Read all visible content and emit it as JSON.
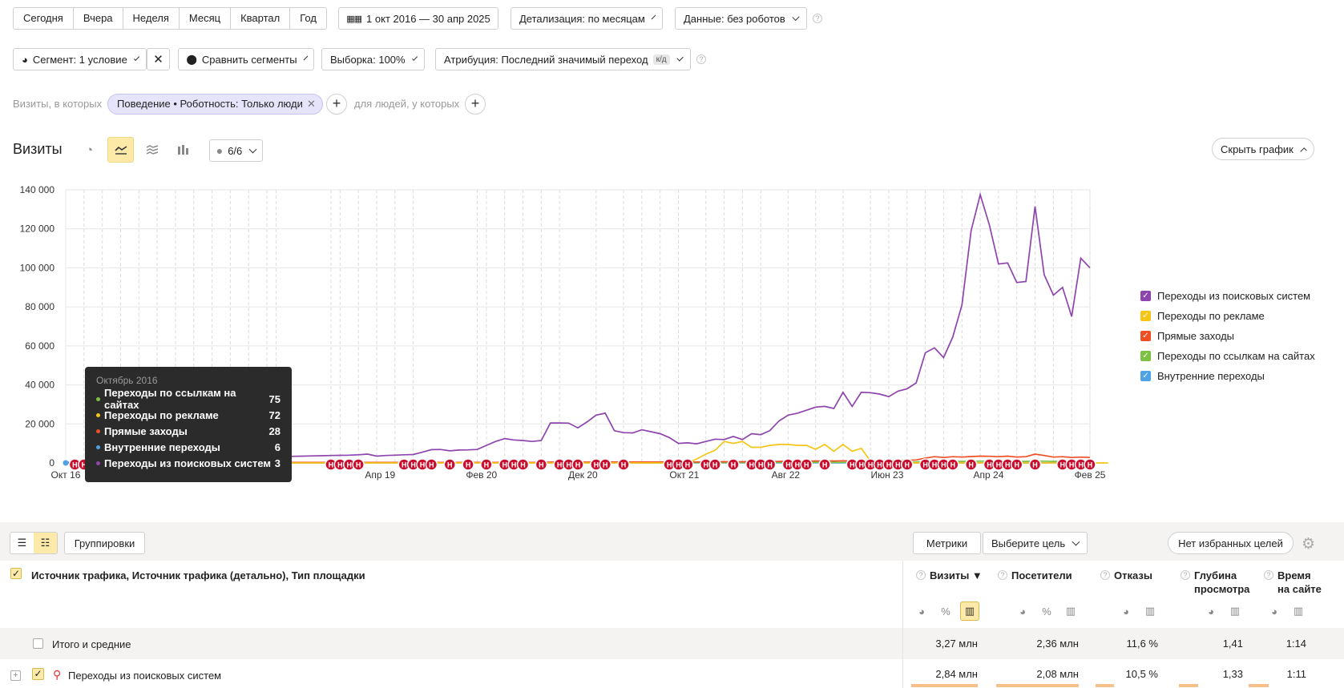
{
  "period_buttons": [
    "Сегодня",
    "Вчера",
    "Неделя",
    "Месяц",
    "Квартал",
    "Год"
  ],
  "date_range": "1 окт 2016 — 30 апр 2025",
  "detail_label": "Детализация: по месяцам",
  "data_label": "Данные: без роботов",
  "segment_label": "Сегмент: 1 условие",
  "compare_label": "Сравнить сегменты",
  "sample_label": "Выборка: 100%",
  "attribution_label": "Атрибуция: Последний значимый переход",
  "attribution_badge": "к/д",
  "visits_in_label": "Визиты, в которых",
  "filter_chip": "Поведение • Роботность: Только люди",
  "people_label": "для людей, у которых",
  "section_title": "Визиты",
  "annotations_count": "6/6",
  "hide_chart_label": "Скрыть график",
  "legend": [
    {
      "label": "Переходы из поисковых систем",
      "color": "#8e44ad"
    },
    {
      "label": "Переходы по рекламе",
      "color": "#f5c518"
    },
    {
      "label": "Прямые заходы",
      "color": "#f04e23"
    },
    {
      "label": "Переходы по ссылкам на сайтах",
      "color": "#7cc142"
    },
    {
      "label": "Внутренние переходы",
      "color": "#4da3e6"
    }
  ],
  "tooltip": {
    "title": "Октябрь 2016",
    "rows": [
      {
        "label": "Переходы по ссылкам на сайтах",
        "value": "75",
        "color": "#7cc142"
      },
      {
        "label": "Переходы по рекламе",
        "value": "72",
        "color": "#f5c518"
      },
      {
        "label": "Прямые заходы",
        "value": "28",
        "color": "#f04e23"
      },
      {
        "label": "Внутренние переходы",
        "value": "6",
        "color": "#4da3e6"
      },
      {
        "label": "Переходы из поисковых систем",
        "value": "3",
        "color": "#8e44ad"
      }
    ]
  },
  "chart_data": {
    "type": "line",
    "y_ticks": [
      "140 000",
      "120 000",
      "100 000",
      "80 000",
      "60 000",
      "40 000",
      "20 000",
      "0"
    ],
    "ylim": [
      0,
      140000
    ],
    "x_ticks": [
      "Окт 16",
      "Апр 19",
      "Фев 20",
      "Дек 20",
      "Окт 21",
      "Авг 22",
      "Июн 23",
      "Апр 24",
      "Фев 25"
    ],
    "x_months": [
      "2016-10",
      "2025-04"
    ],
    "series": [
      {
        "name": "Переходы из поисковых систем",
        "color": "#8e44ad",
        "values": [
          3,
          800,
          1100,
          1200,
          1400,
          1500,
          1600,
          1700,
          1800,
          1900,
          2000,
          2100,
          2200,
          2300,
          2400,
          2500,
          2600,
          2700,
          2800,
          2900,
          3000,
          3000,
          3100,
          3200,
          3300,
          3400,
          3500,
          3600,
          3700,
          3800,
          3900,
          4000,
          4200,
          4500,
          3500,
          3800,
          4000,
          4200,
          4300,
          5500,
          6800,
          6900,
          6200,
          6600,
          6700,
          6900,
          9000,
          11000,
          12500,
          11800,
          11500,
          11000,
          11500,
          20500,
          20500,
          20400,
          18000,
          21000,
          24500,
          25500,
          16500,
          15500,
          15400,
          17000,
          16000,
          15000,
          13000,
          10000,
          10300,
          9800,
          11000,
          12200,
          12000,
          13600,
          12000,
          15000,
          14500,
          16600,
          21500,
          24500,
          25500,
          27000,
          28600,
          29000,
          27900,
          36200,
          29000,
          36200,
          36000,
          35300,
          34000,
          36800,
          38000,
          41000,
          56500,
          59000,
          54000,
          64500,
          81000,
          119000,
          137500,
          122000,
          102000,
          102500,
          92500,
          93000,
          131500,
          96500,
          86000,
          90000,
          75000,
          105000,
          100000
        ]
      },
      {
        "name": "Переходы по рекламе",
        "color": "#f5c518",
        "values": [
          72,
          0,
          0,
          0,
          0,
          0,
          0,
          0,
          0,
          0,
          0,
          0,
          0,
          0,
          0,
          0,
          0,
          0,
          0,
          0,
          0,
          0,
          0,
          0,
          0,
          0,
          0,
          0,
          0,
          0,
          0,
          0,
          0,
          0,
          0,
          0,
          0,
          0,
          0,
          0,
          0,
          0,
          0,
          0,
          0,
          0,
          0,
          0,
          0,
          0,
          0,
          0,
          0,
          0,
          0,
          0,
          0,
          0,
          0,
          0,
          0,
          0,
          0,
          0,
          0,
          0,
          0,
          0,
          0,
          2000,
          4500,
          6500,
          11000,
          10000,
          11000,
          8000,
          8000,
          9000,
          9500,
          9500,
          9000,
          9000,
          7000,
          9500,
          6000,
          9500,
          6000,
          7500,
          1000,
          0,
          0,
          0,
          0,
          0,
          0,
          0,
          0,
          0,
          0,
          0,
          0,
          0,
          0,
          0,
          0,
          0,
          0,
          0,
          0,
          0,
          0,
          0,
          0,
          0,
          0
        ]
      },
      {
        "name": "Прямые заходы",
        "color": "#f04e23",
        "values": [
          28,
          200,
          250,
          250,
          250,
          250,
          250,
          250,
          250,
          250,
          250,
          250,
          250,
          250,
          250,
          250,
          250,
          250,
          250,
          250,
          250,
          250,
          250,
          250,
          250,
          250,
          250,
          250,
          250,
          250,
          250,
          250,
          250,
          250,
          250,
          250,
          250,
          250,
          250,
          300,
          300,
          300,
          300,
          300,
          300,
          300,
          300,
          300,
          300,
          300,
          300,
          300,
          300,
          400,
          400,
          400,
          400,
          400,
          500,
          500,
          500,
          500,
          500,
          500,
          500,
          500,
          500,
          500,
          500,
          500,
          500,
          600,
          600,
          600,
          600,
          700,
          700,
          700,
          800,
          900,
          1000,
          1000,
          1000,
          1100,
          1000,
          1100,
          1000,
          1100,
          1200,
          1200,
          1200,
          1300,
          1400,
          1500,
          2500,
          3200,
          2800,
          3200,
          3000,
          3300,
          3500,
          3400,
          3200,
          3500,
          3000,
          3200,
          4500,
          3800,
          3000,
          3200,
          2800,
          3000,
          2800
        ]
      },
      {
        "name": "Переходы по ссылкам на сайтах",
        "color": "#7cc142",
        "values": [
          75,
          100,
          100,
          100,
          100,
          100,
          100,
          100,
          100,
          100,
          100,
          100,
          100,
          100,
          100,
          100,
          100,
          100,
          100,
          100,
          100,
          100,
          100,
          100,
          100,
          100,
          100,
          100,
          100,
          100,
          100,
          100,
          100,
          100,
          100,
          100,
          100,
          100,
          100,
          150,
          150,
          150,
          150,
          150,
          150,
          150,
          150,
          150,
          150,
          150,
          150,
          150,
          150,
          200,
          200,
          200,
          200,
          200,
          200,
          200,
          200,
          200,
          200,
          200,
          200,
          200,
          200,
          200,
          200,
          200,
          200,
          200,
          200,
          200,
          200,
          200,
          300,
          300,
          300,
          300,
          300,
          300,
          300,
          300,
          300,
          300,
          300,
          300,
          300,
          300,
          300,
          400,
          400,
          500,
          700,
          800,
          700,
          800,
          800,
          900,
          900,
          900,
          800,
          900,
          800,
          800,
          1000,
          900,
          800,
          900,
          800,
          900,
          800
        ]
      },
      {
        "name": "Внутренние переходы",
        "color": "#4da3e6",
        "values": [
          6,
          20,
          20,
          20,
          20,
          20,
          20,
          20,
          20,
          20,
          20,
          20,
          20,
          20,
          20,
          20,
          20,
          20,
          20,
          20,
          20,
          20,
          20,
          20,
          20,
          20,
          20,
          20,
          20,
          20,
          20,
          20,
          20,
          20,
          20,
          20,
          20,
          20,
          20,
          30,
          30,
          30,
          30,
          30,
          30,
          30,
          30,
          30,
          30,
          30,
          30,
          30,
          30,
          30,
          30,
          30,
          30,
          30,
          30,
          30,
          30,
          30,
          30,
          30,
          30,
          30,
          30,
          30,
          30,
          30,
          30,
          30,
          30,
          30,
          30,
          30,
          40,
          40,
          40,
          40,
          40,
          40,
          40,
          40,
          40,
          40,
          40,
          40,
          40,
          40,
          40,
          40,
          40,
          40,
          50,
          50,
          50,
          50,
          50,
          50,
          50,
          50,
          50,
          50,
          50,
          50,
          50,
          50,
          50,
          50,
          50,
          50,
          50
        ]
      }
    ]
  },
  "table": {
    "view_toggle": "Группировки",
    "metrics_btn": "Метрики",
    "goal_btn": "Выберите цель",
    "fav_goals_btn": "Нет избранных целей",
    "dimension_header": "Источник трафика, Источник трафика (детально), Тип площадки",
    "columns": [
      {
        "line1": "Визиты",
        "line2": ""
      },
      {
        "line1": "Посетители",
        "line2": ""
      },
      {
        "line1": "Отказы",
        "line2": ""
      },
      {
        "line1": "Глубина",
        "line2": "просмотра"
      },
      {
        "line1": "Время",
        "line2": "на сайте"
      }
    ],
    "totals": {
      "label": "Итого и средние",
      "values": [
        "3,27 млн",
        "2,36 млн",
        "11,6 %",
        "1,41",
        "1:14"
      ]
    },
    "rows": [
      {
        "label": "Переходы из поисковых систем",
        "values": [
          "2,84 млн",
          "2,08 млн",
          "10,5 %",
          "1,33",
          "1:11"
        ]
      }
    ]
  }
}
